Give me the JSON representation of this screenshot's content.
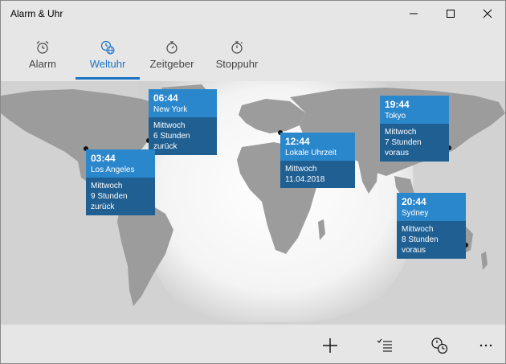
{
  "window": {
    "title": "Alarm & Uhr"
  },
  "tabs": [
    {
      "label": "Alarm",
      "icon": "alarm-clock-icon"
    },
    {
      "label": "Weltuhr",
      "icon": "world-clock-icon",
      "active": true
    },
    {
      "label": "Zeitgeber",
      "icon": "timer-icon"
    },
    {
      "label": "Stoppuhr",
      "icon": "stopwatch-icon"
    }
  ],
  "clocks": [
    {
      "time": "06:44",
      "city": "New York",
      "day": "Mittwoch",
      "diff": "6 Stunden zurück"
    },
    {
      "time": "03:44",
      "city": "Los Angeles",
      "day": "Mittwoch",
      "diff": "9 Stunden zurück"
    },
    {
      "time": "12:44",
      "city": "Lokale Uhrzeit",
      "day": "Mittwoch",
      "diff": "11.04.2018"
    },
    {
      "time": "19:44",
      "city": "Tokyo",
      "day": "Mittwoch",
      "diff": "7 Stunden voraus"
    },
    {
      "time": "20:44",
      "city": "Sydney",
      "day": "Mittwoch",
      "diff": "8 Stunden voraus"
    }
  ],
  "commands": [
    {
      "icon": "add-icon"
    },
    {
      "icon": "select-list-icon"
    },
    {
      "icon": "compare-time-icon"
    },
    {
      "icon": "more-icon"
    }
  ],
  "colors": {
    "accent": "#1a73c4",
    "card_top": "#2b87cc",
    "card_bottom": "#1f5f92",
    "land": "#9c9c9c",
    "background": "#e6e6e6"
  }
}
